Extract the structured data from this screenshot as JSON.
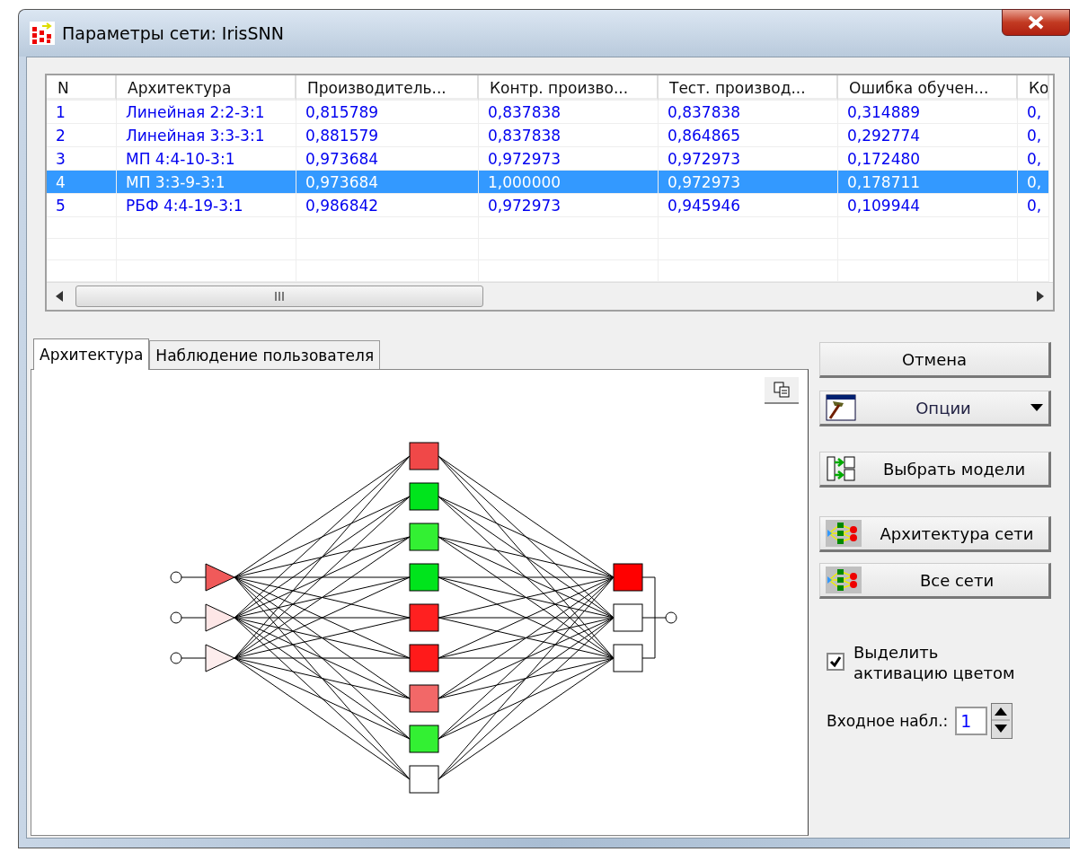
{
  "window": {
    "title": "Параметры сети: IrisSNN"
  },
  "table": {
    "columns": [
      "N",
      "Архитектура",
      "Производитель...",
      "Контр. произво...",
      "Тест. производ...",
      "Ошибка обучен...",
      "Ко"
    ],
    "rows": [
      {
        "cells": [
          "1",
          "Линейная 2:2-3:1",
          "0,815789",
          "0,837838",
          "0,837838",
          "0,314889",
          "0,"
        ],
        "selected": false
      },
      {
        "cells": [
          "2",
          "Линейная 3:3-3:1",
          "0,881579",
          "0,837838",
          "0,864865",
          "0,292774",
          "0,"
        ],
        "selected": false
      },
      {
        "cells": [
          "3",
          "МП 4:4-10-3:1",
          "0,973684",
          "0,972973",
          "0,972973",
          "0,172480",
          "0,"
        ],
        "selected": false
      },
      {
        "cells": [
          "4",
          "МП 3:3-9-3:1",
          "0,973684",
          "1,000000",
          "0,972973",
          "0,178711",
          "0,"
        ],
        "selected": true
      },
      {
        "cells": [
          "5",
          "РБФ 4:4-19-3:1",
          "0,986842",
          "0,972973",
          "0,945946",
          "0,109944",
          "0,"
        ],
        "selected": false
      }
    ]
  },
  "tabs": [
    {
      "label": "Архитектура",
      "selected": true
    },
    {
      "label": "Наблюдение пользователя",
      "selected": false
    }
  ],
  "network": {
    "inputs": [
      {
        "color": "#f05a5a"
      },
      {
        "color": "#fde6e6"
      },
      {
        "color": "#fdeded"
      }
    ],
    "hidden": [
      {
        "color": "#f04848"
      },
      {
        "color": "#00e41c"
      },
      {
        "color": "#33f033"
      },
      {
        "color": "#00e41c"
      },
      {
        "color": "#ff2020"
      },
      {
        "color": "#ff1a1a"
      },
      {
        "color": "#f26868"
      },
      {
        "color": "#33f033"
      },
      {
        "color": "#ffffff"
      }
    ],
    "outputs": [
      {
        "color": "#ff0000"
      },
      {
        "color": "#ffffff"
      },
      {
        "color": "#ffffff"
      }
    ]
  },
  "buttons": [
    {
      "label": "Отмена",
      "kind": "plain"
    },
    {
      "label": "Опции",
      "kind": "menu"
    },
    {
      "label": "Выбрать модели",
      "kind": "models"
    },
    {
      "label": "Архитектура сети",
      "kind": "network"
    },
    {
      "label": "Все сети",
      "kind": "network"
    }
  ],
  "highlight_checkbox": {
    "label": "Выделить\nактивацию цветом",
    "checked": true
  },
  "input_case": {
    "label": "Входное набл.:",
    "value": "1"
  }
}
